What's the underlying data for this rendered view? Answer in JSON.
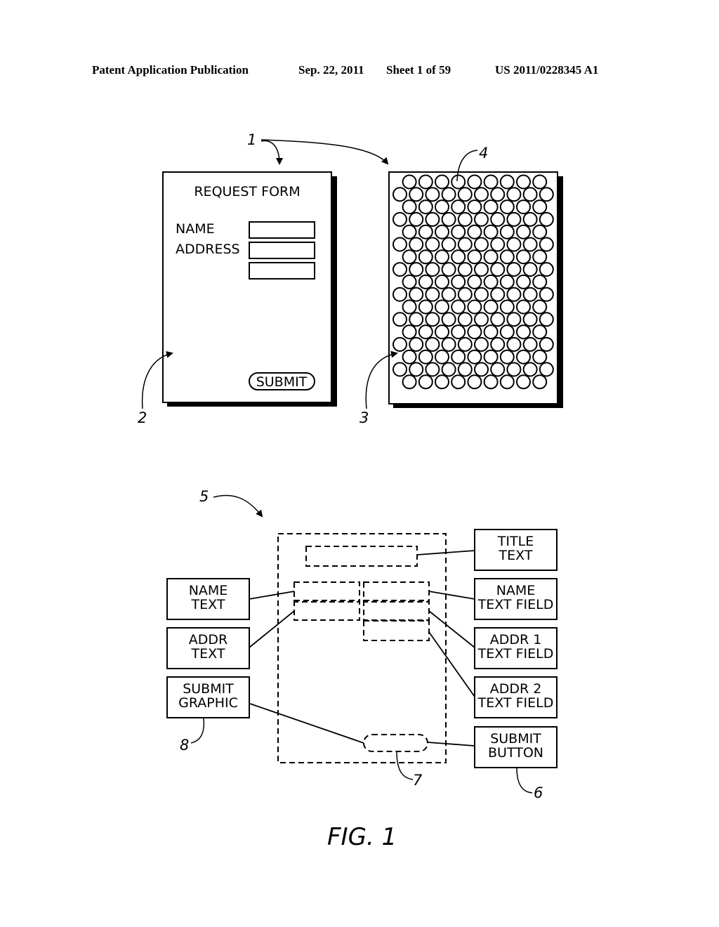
{
  "header": {
    "publication": "Patent Application Publication",
    "date": "Sep. 22, 2011",
    "sheet": "Sheet 1 of 59",
    "patent_number": "US 2011/0228345 A1"
  },
  "figure": {
    "label": "FIG. 1",
    "ref_numerals": {
      "form_set": "1",
      "form_page": "2",
      "pattern_page": "3",
      "coded_dot": "4",
      "form_description": "5",
      "submit_button_ref": "6",
      "submit_region": "7",
      "submit_graphic_ref": "8"
    },
    "request_form": {
      "title": "REQUEST FORM",
      "name_label": "NAME",
      "address_label": "ADDRESS",
      "submit_label": "SUBMIT"
    },
    "pattern": {
      "rows": 17,
      "long_row_count": 10,
      "short_row_count": 9
    },
    "element_boxes": {
      "title_text": [
        "TITLE",
        "TEXT"
      ],
      "name_text": [
        "NAME",
        "TEXT"
      ],
      "addr_text": [
        "ADDR",
        "TEXT"
      ],
      "submit_graphic": [
        "SUBMIT",
        "GRAPHIC"
      ],
      "name_text_field": [
        "NAME",
        "TEXT FIELD"
      ],
      "addr1_text_field": [
        "ADDR 1",
        "TEXT FIELD"
      ],
      "addr2_text_field": [
        "ADDR 2",
        "TEXT FIELD"
      ],
      "submit_button": [
        "SUBMIT",
        "BUTTON"
      ]
    }
  }
}
